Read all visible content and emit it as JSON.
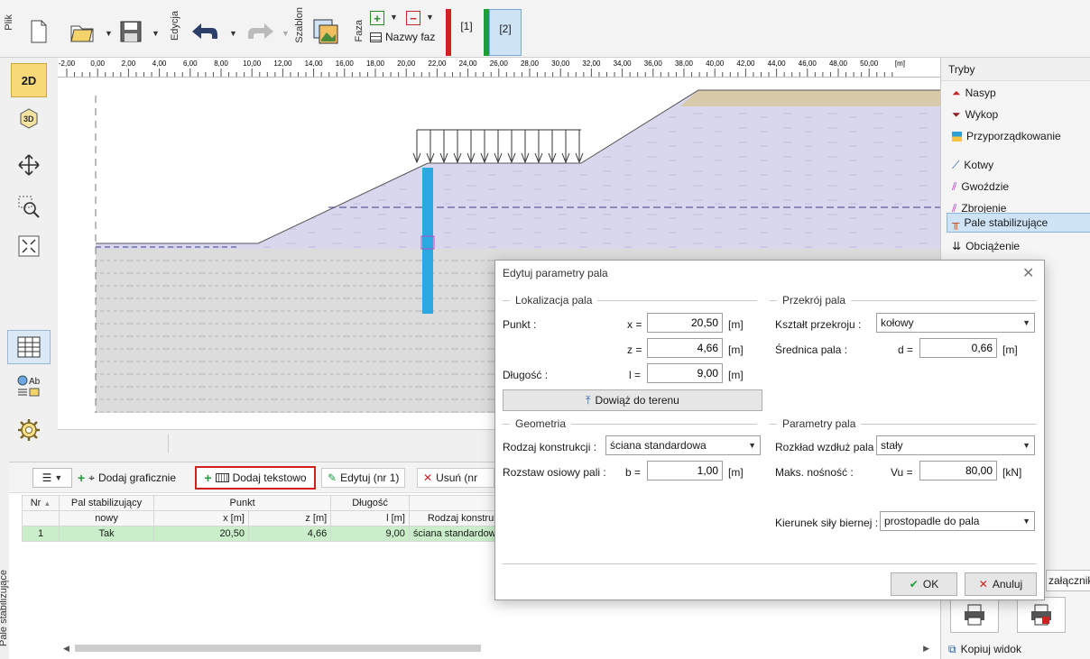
{
  "toolbar": {
    "plik": "Plik",
    "edycja": "Edycja",
    "szablon": "Szablon",
    "faza": "Faza",
    "nazwy_faz": "Nazwy faz",
    "phase1": "[1]",
    "phase2": "[2]"
  },
  "left_toolbar": {
    "view_2d": "2D",
    "view_3d": "3D",
    "ab": "Ab"
  },
  "ruler": {
    "ticks": [
      "-2,00",
      "0,00",
      "2,00",
      "4,00",
      "6,00",
      "8,00",
      "10,00",
      "12,00",
      "14,00",
      "16,00",
      "18,00",
      "20,00",
      "22,00",
      "24,00",
      "26,00",
      "28,00",
      "30,00",
      "32,00",
      "34,00",
      "36,00",
      "38,00",
      "40,00",
      "42,00",
      "44,00",
      "46,00",
      "48,00",
      "50,00",
      "[m]"
    ]
  },
  "right_panel": {
    "title": "Tryby",
    "items": [
      "Nasyp",
      "Wykop",
      "Przyporządkowanie",
      "Kotwy",
      "Gwoździe",
      "Zbrojenie",
      "Pale stabilizujące",
      "Obciążenie"
    ],
    "zalacz": "załączników",
    "copy_view": "Kopiuj widok"
  },
  "bottom": {
    "side_tab": "Pale stabilizujące",
    "add_graph": "Dodaj graficznie",
    "add_text": "Dodaj tekstowo",
    "edit": "Edytuj (nr 1)",
    "delete": "Usuń (nr",
    "headers": {
      "nr": "Nr",
      "pal": "Pal stabilizujący",
      "nowy": "nowy",
      "punkt": "Punkt",
      "x": "x [m]",
      "z": "z [m]",
      "dlugosc": "Długość",
      "l": "l [m]",
      "rodzaj": "Rodzaj konstrukcji"
    },
    "row": {
      "nr": "1",
      "pal": "Tak",
      "x": "20,50",
      "z": "4,66",
      "l": "9,00",
      "rodzaj": "ściana standardowa"
    }
  },
  "dialog": {
    "title": "Edytuj parametry pala",
    "loc_section": "Lokalizacja pala",
    "punkt": "Punkt :",
    "x_lbl": "x =",
    "x_val": "20,50",
    "z_lbl": "z =",
    "z_val": "4,66",
    "unit_m": "[m]",
    "dlugosc": "Długość :",
    "l_lbl": "l =",
    "l_val": "9,00",
    "attach": "Dowiąż do terenu",
    "geo_section": "Geometria",
    "rodzaj": "Rodzaj konstrukcji :",
    "rodzaj_val": "ściana standardowa",
    "rozstaw": "Rozstaw osiowy pali :",
    "b_lbl": "b =",
    "b_val": "1,00",
    "cross_section": "Przekrój pala",
    "ksztalt": "Kształt przekroju :",
    "ksztalt_val": "kołowy",
    "srednica": "Średnica pala :",
    "d_lbl": "d =",
    "d_val": "0,66",
    "param_section": "Parametry pala",
    "rozklad": "Rozkład wzdłuż pala :",
    "rozklad_val": "stały",
    "maks": "Maks. nośność :",
    "vu_lbl": "Vu =",
    "vu_val": "80,00",
    "unit_kn": "[kN]",
    "kierunek": "Kierunek siły biernej :",
    "kierunek_val": "prostopadle do pala",
    "ok": "OK",
    "cancel": "Anuluj"
  },
  "colors": {
    "accent_red": "#d21f1f",
    "phase_green": "#1e9e3a",
    "pile_blue": "#2ba8e0",
    "soil_purple": "#d9d7ee",
    "soil_grey": "#dcdcdc",
    "soil_tan": "#d8c9a8"
  }
}
